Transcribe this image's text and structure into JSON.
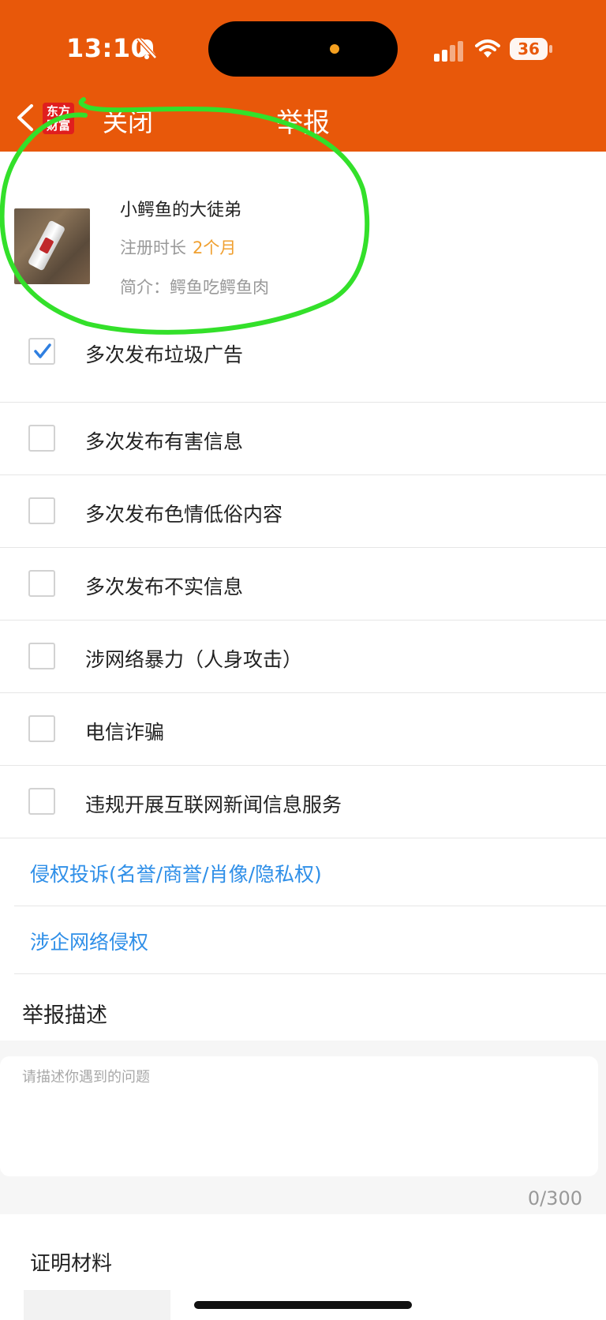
{
  "status_bar": {
    "time": "13:10",
    "battery": "36",
    "icons": [
      "bell-muted-icon",
      "signal-icon",
      "wifi-icon",
      "battery-icon"
    ]
  },
  "nav": {
    "logo_line1": "东方",
    "logo_line2": "财富",
    "close_label": "关闭",
    "title": "举报",
    "back_icon": "chevron-left-icon"
  },
  "profile": {
    "nickname": "小鳄鱼的大徒弟",
    "reg_label": "注册时长",
    "reg_value": "2个月",
    "bio": "简介：鳄鱼吃鳄鱼肉"
  },
  "options": [
    {
      "label": "多次发布垃圾广告",
      "checked": true
    },
    {
      "label": "多次发布有害信息",
      "checked": false
    },
    {
      "label": "多次发布色情低俗内容",
      "checked": false
    },
    {
      "label": "多次发布不实信息",
      "checked": false
    },
    {
      "label": "涉网络暴力（人身攻击）",
      "checked": false
    },
    {
      "label": "电信诈骗",
      "checked": false
    },
    {
      "label": "违规开展互联网新闻信息服务",
      "checked": false
    }
  ],
  "links": [
    "侵权投诉(名誉/商誉/肖像/隐私权)",
    "涉企网络侵权"
  ],
  "description": {
    "title": "举报描述",
    "placeholder": "请描述你遇到的问题",
    "counter": "0/300"
  },
  "proof": {
    "title": "证明材料"
  },
  "colors": {
    "header": "#e8580a",
    "link": "#2f8fe8",
    "accent": "#f0a030",
    "check": "#2f7fe0",
    "annotation": "#33e02a"
  }
}
